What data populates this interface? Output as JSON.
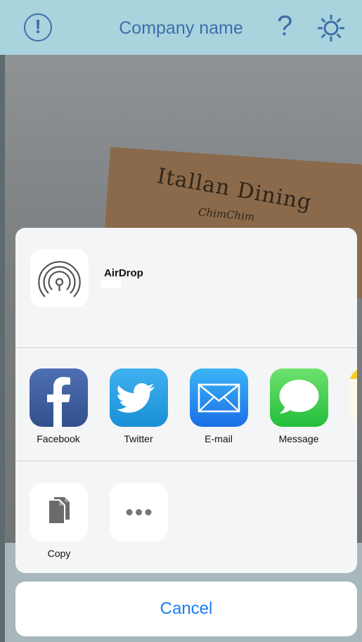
{
  "navbar": {
    "title": "Company name",
    "help_symbol": "?",
    "alert_symbol": "!"
  },
  "background_photo": {
    "sign_line1": "Itallan Dining",
    "sign_line2": "ChimChim"
  },
  "share_sheet": {
    "airdrop": {
      "label": "AirDrop"
    },
    "apps": [
      {
        "label": "Facebook",
        "icon": "facebook-icon"
      },
      {
        "label": "Twitter",
        "icon": "twitter-icon"
      },
      {
        "label": "E-mail",
        "icon": "mail-icon"
      },
      {
        "label": "Message",
        "icon": "message-icon"
      }
    ],
    "actions": [
      {
        "label": "Copy",
        "icon": "copy-icon"
      },
      {
        "label": "",
        "icon": "more-icon"
      }
    ]
  },
  "cancel_label": "Cancel",
  "colors": {
    "navbar_bg": "#a9d4de",
    "navbar_fg": "#3d6ea9",
    "accent_blue": "#1e7cf4",
    "sheet_bg": "#f4f5f6"
  }
}
